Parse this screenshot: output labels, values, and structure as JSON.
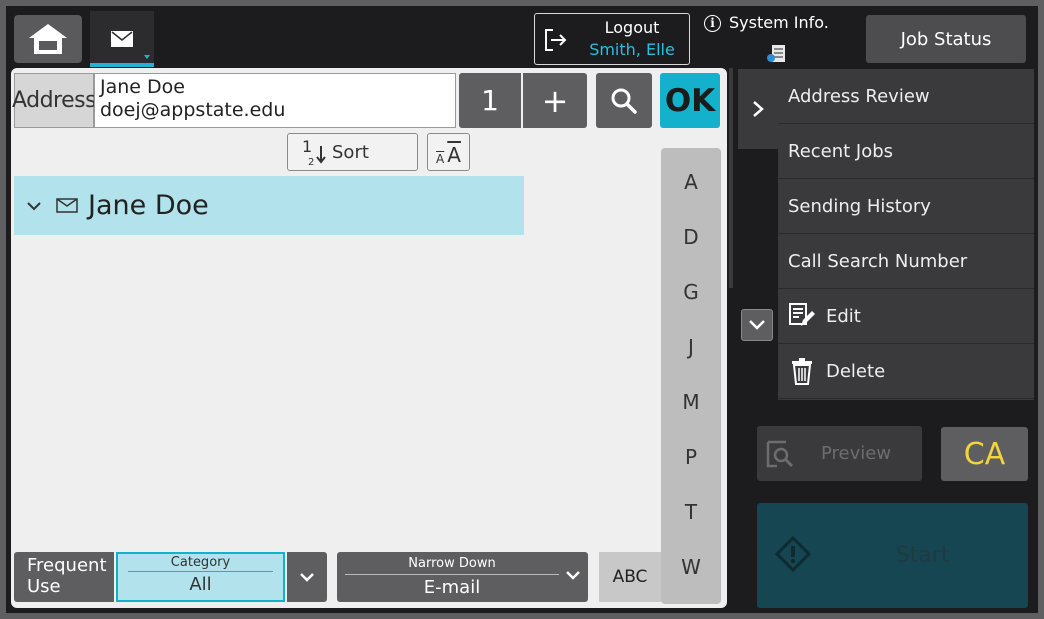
{
  "topbar": {
    "home_icon": "home-icon",
    "mail_icon": "envelope-icon",
    "logout_label": "Logout",
    "logout_user": "Smith, Elle",
    "system_info_label": "System Info.",
    "job_status_label": "Job Status"
  },
  "address": {
    "label": "Address",
    "name": "Jane Doe",
    "email": "doej@appstate.edu",
    "count": "1",
    "plus": "+",
    "ok": "OK"
  },
  "toolbar": {
    "sort_label": "Sort",
    "sort_digit_top": "1",
    "sort_digit_bottom": "2",
    "font_small": "A",
    "font_large": "A"
  },
  "list": {
    "rows": [
      {
        "name": "Jane Doe",
        "selected": true
      }
    ]
  },
  "alphabet": [
    "A",
    "D",
    "G",
    "J",
    "M",
    "P",
    "T",
    "W"
  ],
  "filters": {
    "frequent_use_line1": "Frequent",
    "frequent_use_line2": "Use",
    "category_title": "Category",
    "category_value": "All",
    "narrow_title": "Narrow Down",
    "narrow_value": "E-mail",
    "abc_label": "ABC"
  },
  "side_menu": {
    "items": [
      {
        "label": "Address Review",
        "icon": ""
      },
      {
        "label": "Recent Jobs",
        "icon": ""
      },
      {
        "label": "Sending History",
        "icon": ""
      },
      {
        "label": "Call Search Number",
        "icon": ""
      },
      {
        "label": "Edit",
        "icon": "edit-icon"
      },
      {
        "label": "Delete",
        "icon": "trash-icon"
      }
    ]
  },
  "actions": {
    "preview_label": "Preview",
    "ca_label": "CA",
    "start_label": "Start"
  },
  "colors": {
    "accent": "#14b1cc",
    "selected_row": "#b2e2ec",
    "ca_text": "#f2d43c",
    "start_bg": "#164651"
  }
}
